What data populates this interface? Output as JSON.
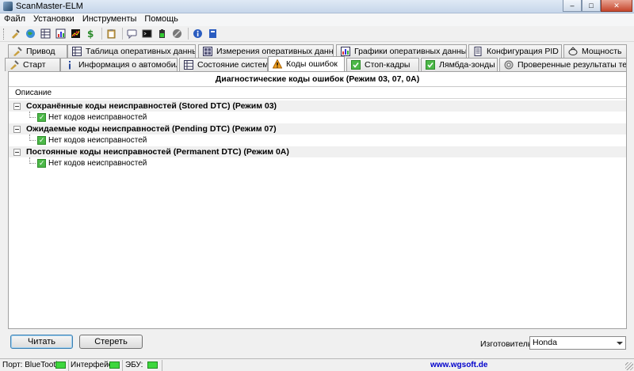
{
  "window": {
    "title": "ScanMaster-ELM",
    "buttons": {
      "minimize": "–",
      "maximize": "□",
      "close": "✕"
    }
  },
  "menu": {
    "items": [
      {
        "label": "Файл"
      },
      {
        "label": "Установки"
      },
      {
        "label": "Инструменты"
      },
      {
        "label": "Помощь"
      }
    ]
  },
  "toolbar": {
    "icons": [
      "connect-icon",
      "globe-icon",
      "table-icon",
      "chart-icon",
      "graph-icon",
      "dollar-icon",
      "clipboard-icon",
      "chat-icon",
      "terminal-icon",
      "battery-icon",
      "stop-icon",
      "info-icon",
      "book-icon"
    ]
  },
  "tabs": {
    "row1": [
      {
        "label": "Привод",
        "icon": "drive-icon"
      },
      {
        "label": "Таблица оперативных данных",
        "icon": "table-icon"
      },
      {
        "label": "Измерения оперативных данных",
        "icon": "gauge-icon"
      },
      {
        "label": "Графики оперативных данных",
        "icon": "chart-icon"
      },
      {
        "label": "Конфигурация PID",
        "icon": "config-icon"
      },
      {
        "label": "Мощность",
        "icon": "power-icon"
      }
    ],
    "row2": [
      {
        "label": "Старт",
        "icon": "start-icon"
      },
      {
        "label": "Информация о автомобиле",
        "icon": "info-icon"
      },
      {
        "label": "Состояние системы",
        "icon": "system-icon"
      },
      {
        "label": "Коды ошибок",
        "icon": "warning-icon",
        "active": true
      },
      {
        "label": "Стоп-кадры",
        "icon": "freeze-frame-icon"
      },
      {
        "label": "Лямбда-зонды",
        "icon": "lambda-icon"
      },
      {
        "label": "Проверенные результаты теста",
        "icon": "test-icon"
      }
    ]
  },
  "dtc": {
    "header": "Диагностические коды ошибок (Режим 03, 07, 0A)",
    "column": "Описание",
    "groups": [
      {
        "title": "Сохранённые коды неисправностей (Stored DTC) (Режим 03)",
        "items": [
          "Нет кодов неисправностей"
        ]
      },
      {
        "title": "Ожидаемые коды неисправностей (Pending DTC) (Режим 07)",
        "items": [
          "Нет кодов неисправностей"
        ]
      },
      {
        "title": "Постоянные коды неисправностей (Permanent DTC) (Режим 0A)",
        "items": [
          "Нет кодов неисправностей"
        ]
      }
    ]
  },
  "actions": {
    "read_label": "Читать",
    "erase_label": "Стереть",
    "manufacturer_label": "Изготовитель",
    "manufacturer_value": "Honda"
  },
  "status": {
    "port": "Порт: BlueTooth",
    "interface": "Интерфейс:",
    "ecu": "ЭБУ:",
    "url": "www.wgsoft.de"
  },
  "colors": {
    "led_green": "#3dd63d",
    "ok_green": "#4cb848",
    "warning_orange": "#f0a020",
    "link_blue": "#0000cc"
  }
}
